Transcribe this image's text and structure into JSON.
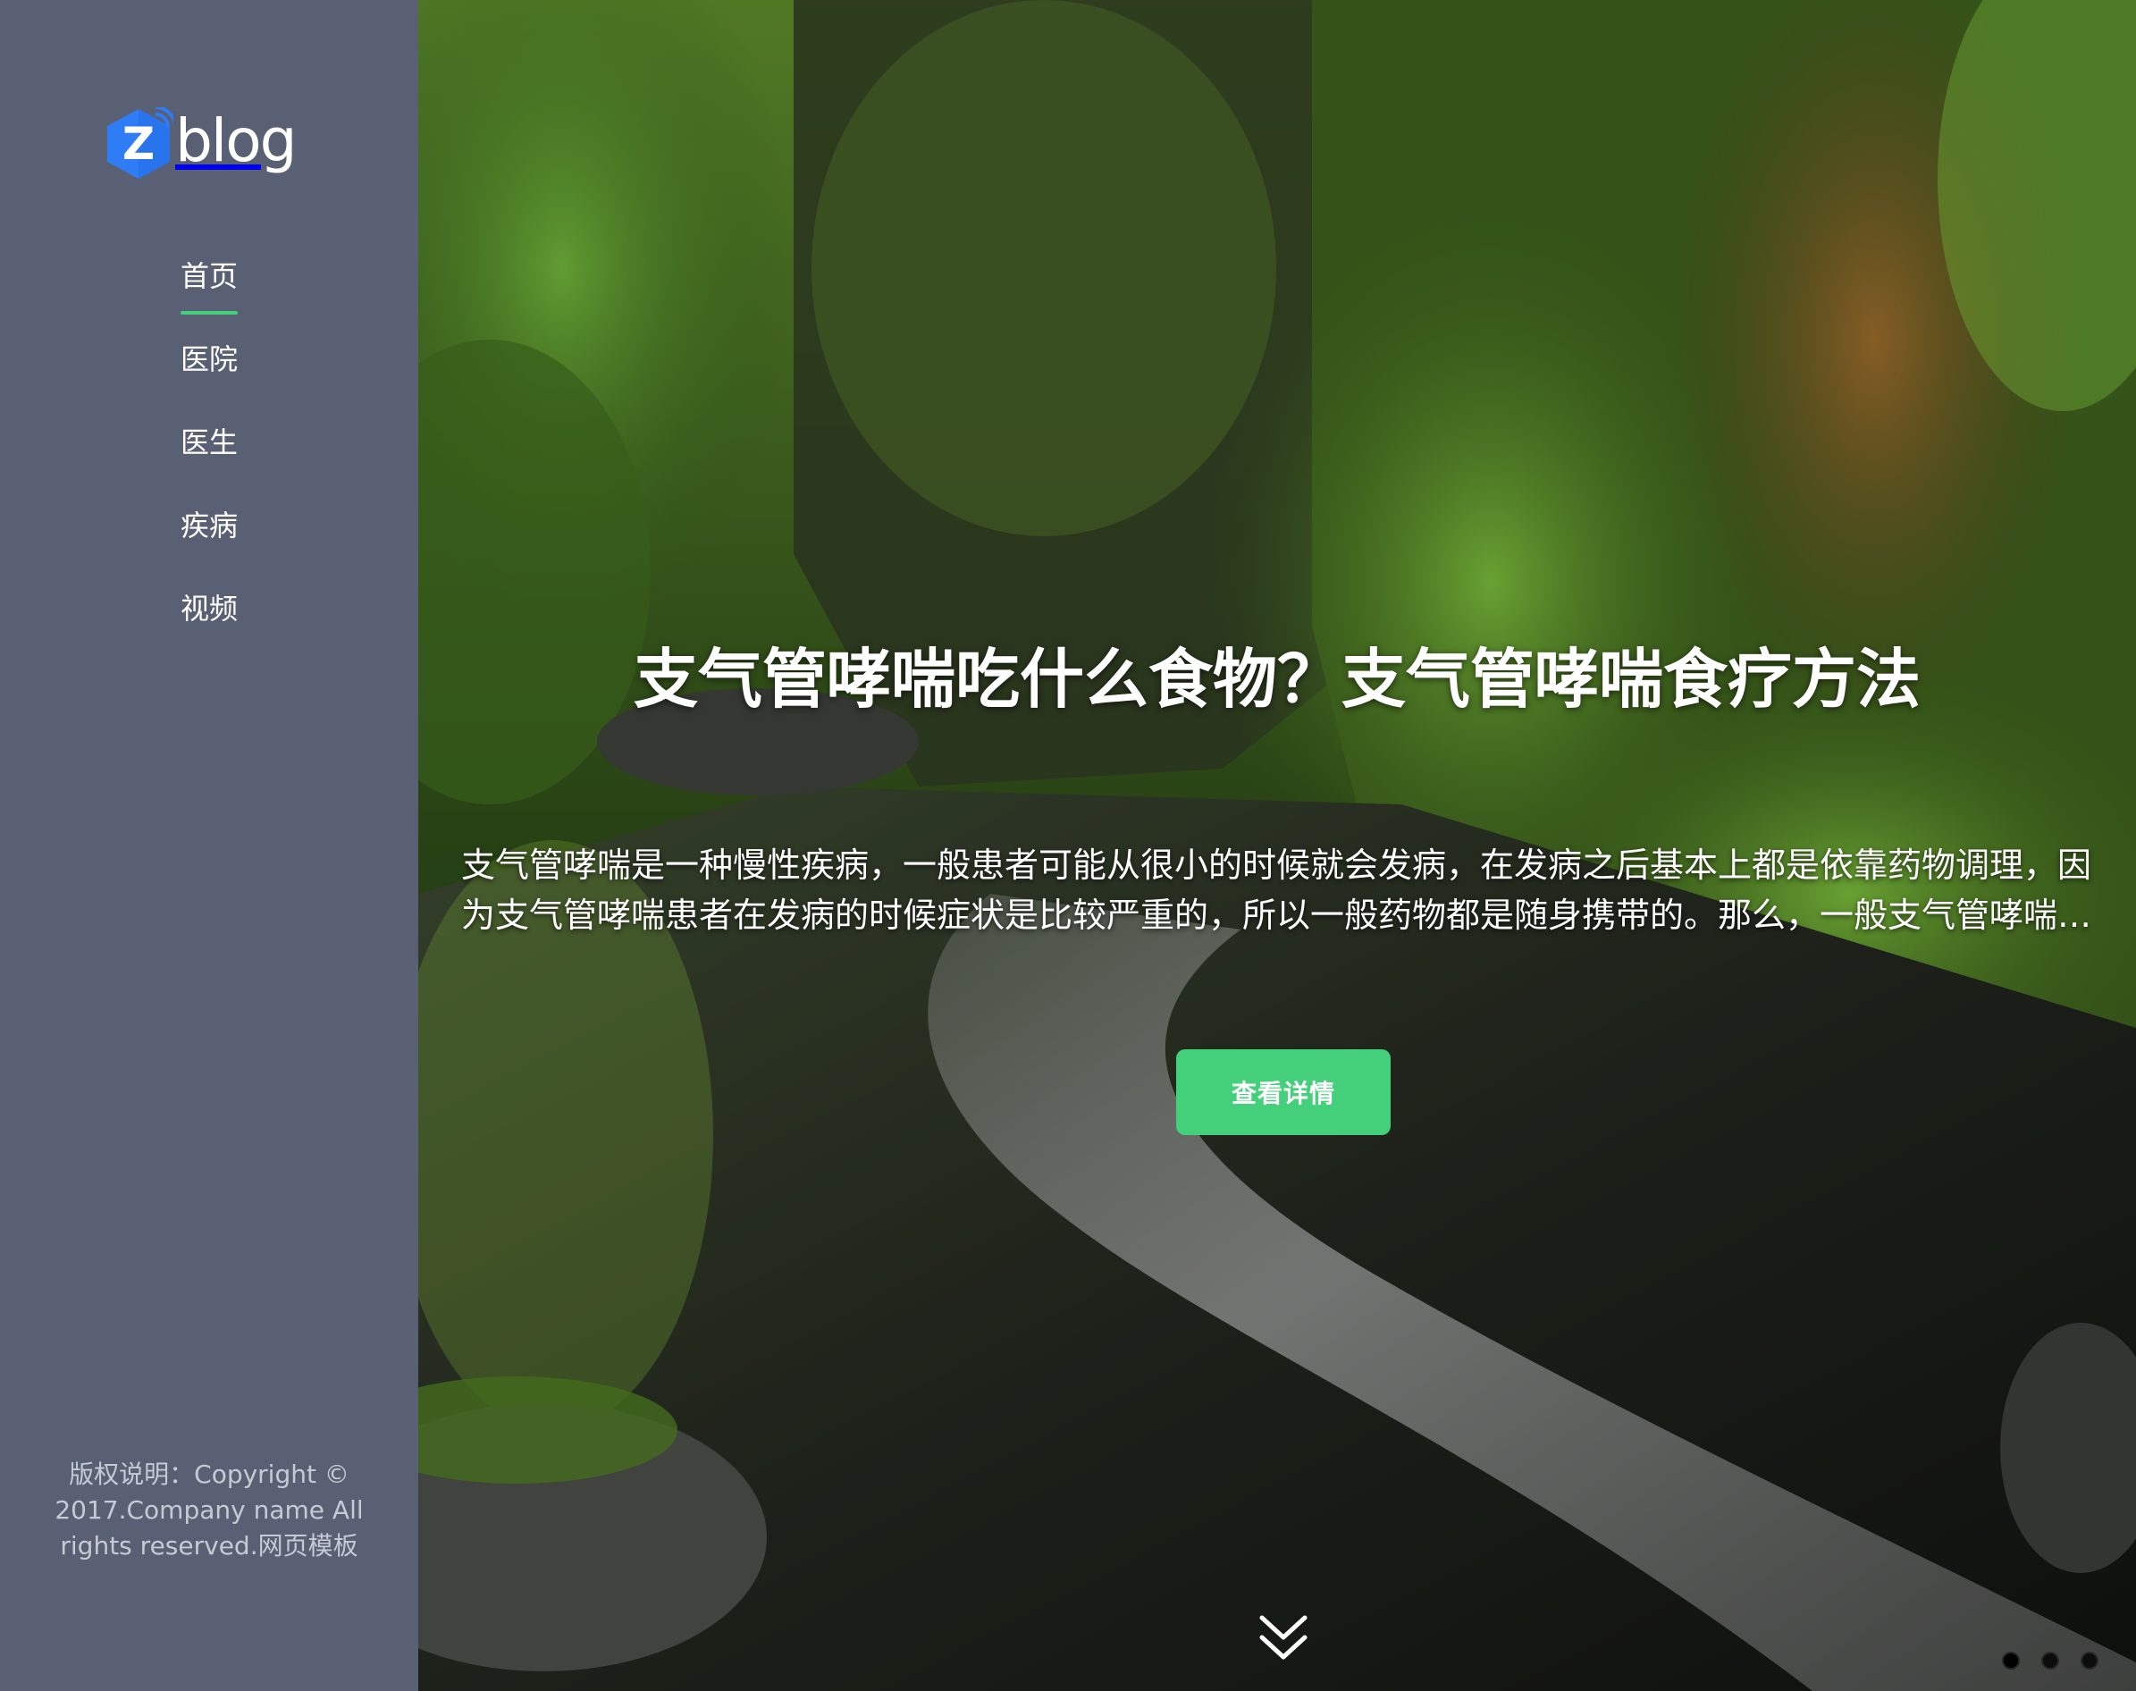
{
  "brand": {
    "name": "blog",
    "logo_letter": "Z",
    "accent_color": "#2e7df7"
  },
  "sidebar": {
    "background": "#5a6073",
    "active_color": "#44d07a",
    "items": [
      {
        "label": "首页",
        "active": true
      },
      {
        "label": "医院",
        "active": false
      },
      {
        "label": "医生",
        "active": false
      },
      {
        "label": "疾病",
        "active": false
      },
      {
        "label": "视频",
        "active": false
      }
    ],
    "copyright": "版权说明：Copyright © 2017.Company name All rights reserved.网页模板"
  },
  "hero": {
    "title": "支气管哮喘吃什么食物？支气管哮喘食疗方法",
    "description": "支气管哮喘是一种慢性疾病，一般患者可能从很小的时候就会发病，在发病之后基本上都是依靠药物调理，因为支气管哮喘患者在发病的时候症状是比较严重的，所以一般药物都是随身携带的。那么，一般支气管哮喘患者吃什么食物好呢？",
    "button_label": "查看详情",
    "button_color": "#44d07a",
    "scroll_icon": "double-chevron-down-icon",
    "slide_count": 3,
    "active_slide": 1
  }
}
